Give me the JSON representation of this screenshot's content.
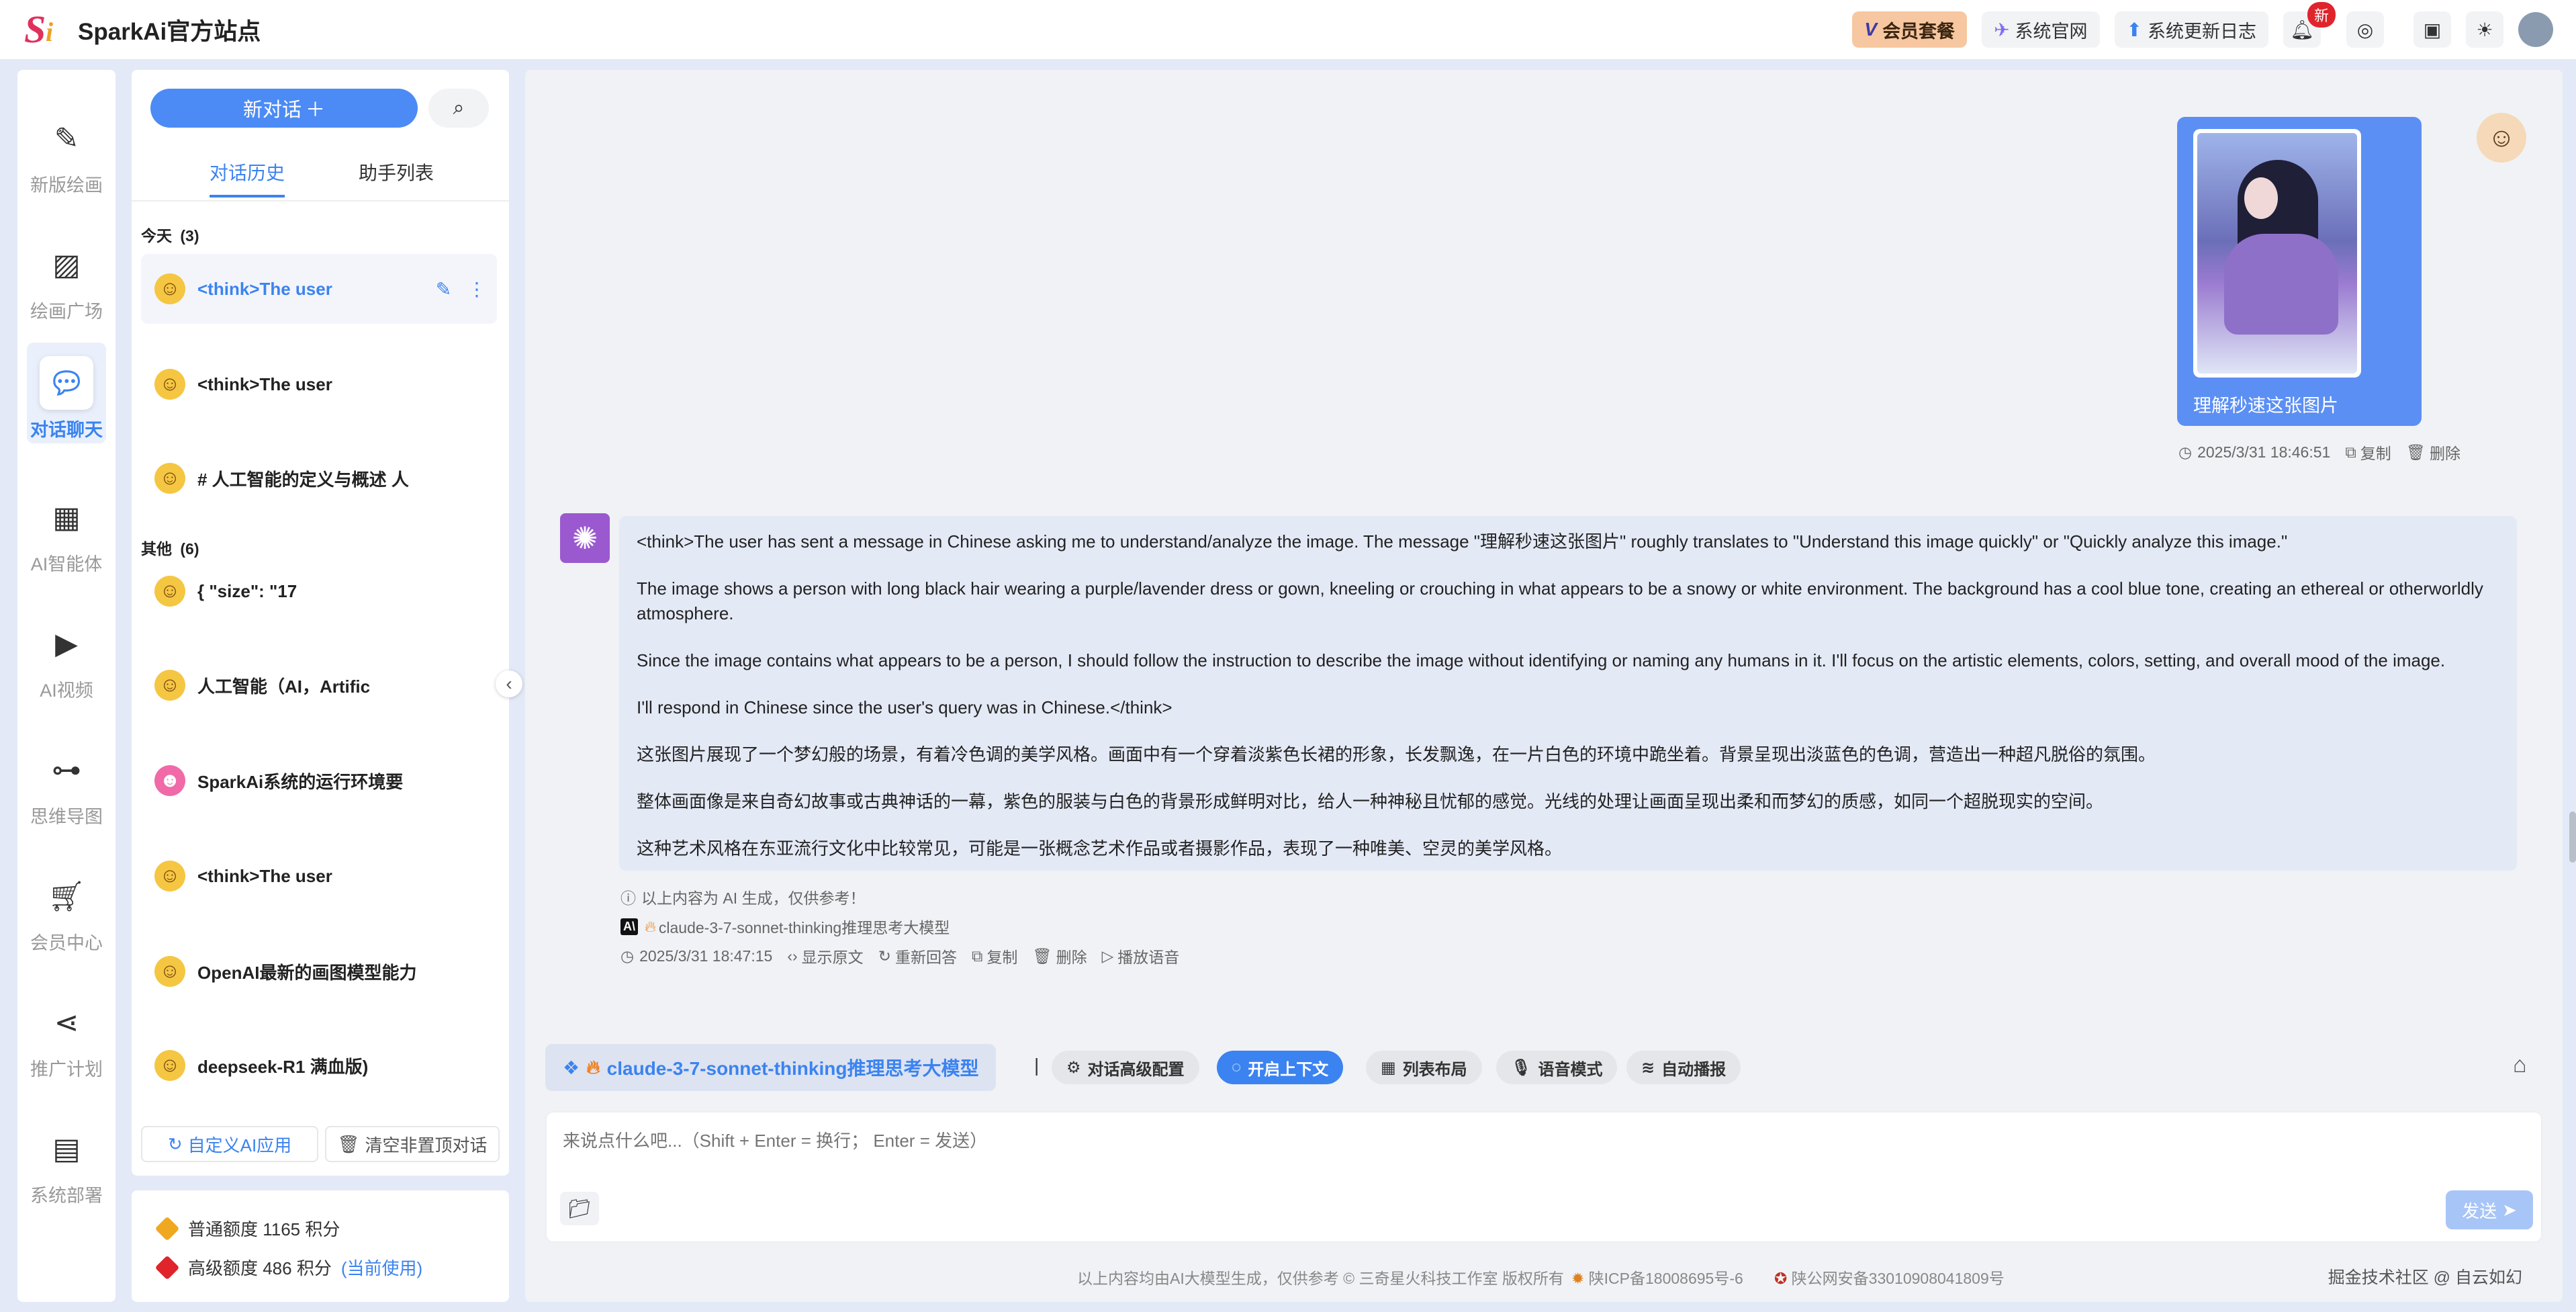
{
  "app": {
    "title": "SparkAi官方站点",
    "logo": "Si"
  },
  "header": {
    "vip_label": "会员套餐",
    "official_site_label": "系统官网",
    "changelog_label": "系统更新日志",
    "notification_badge": "新"
  },
  "nav": {
    "items": [
      {
        "label": "新版绘画",
        "icon": "paint-brush-icon"
      },
      {
        "label": "绘画广场",
        "icon": "image-icon"
      },
      {
        "label": "对话聊天",
        "icon": "chat-icon"
      },
      {
        "label": "AI智能体",
        "icon": "grid-icon"
      },
      {
        "label": "AI视频",
        "icon": "video-icon"
      },
      {
        "label": "思维导图",
        "icon": "mindmap-icon"
      },
      {
        "label": "会员中心",
        "icon": "cart-icon"
      },
      {
        "label": "推广计划",
        "icon": "share-icon"
      },
      {
        "label": "系统部署",
        "icon": "deploy-icon"
      }
    ]
  },
  "sidebar": {
    "new_chat_label": "新对话",
    "tabs": [
      "对话历史",
      "助手列表"
    ],
    "groups": [
      {
        "label": "今天",
        "count": "(3)"
      },
      {
        "label": "其他",
        "count": "(6)"
      }
    ],
    "conversations": [
      "<think>The user",
      "<think>The user",
      "# 人工智能的定义与概述 人",
      "{ \"size\": \"17",
      "人工智能（AI，Artific",
      "SparkAi系统的运行环境要",
      "<think>The user",
      "OpenAI最新的画图模型能力",
      "deepseek-R1 满血版)"
    ],
    "custom_app_label": "自定义AI应用",
    "clear_label": "清空非置顶对话"
  },
  "quota": {
    "normal": "普通额度 1165 积分",
    "premium": "高级额度 486 积分",
    "premium_current": "(当前使用)"
  },
  "chat": {
    "user_message": "理解秒速这张图片",
    "user_time": "2025/3/31 18:46:51",
    "copy_label": "复制",
    "delete_label": "删除",
    "bot_paragraphs": [
      "<think>The user has sent a message in Chinese asking me to understand/analyze the image. The message \"理解秒速这张图片\" roughly translates to \"Understand this image quickly\" or \"Quickly analyze this image.\"",
      "The image shows a person with long black hair wearing a purple/lavender dress or gown, kneeling or crouching in what appears to be a snowy or white environment. The background has a cool blue tone, creating an ethereal or otherworldly atmosphere.",
      "Since the image contains what appears to be a person, I should follow the instruction to describe the image without identifying or naming any humans in it. I'll focus on the artistic elements, colors, setting, and overall mood of the image.",
      "I'll respond in Chinese since the user's query was in Chinese.</think>",
      "这张图片展现了一个梦幻般的场景，有着冷色调的美学风格。画面中有一个穿着淡紫色长裙的形象，长发飘逸，在一片白色的环境中跪坐着。背景呈现出淡蓝色的色调，营造出一种超凡脱俗的氛围。",
      "整体画面像是来自奇幻故事或古典神话的一幕，紫色的服装与白色的背景形成鲜明对比，给人一种神秘且忧郁的感觉。光线的处理让画面呈现出柔和而梦幻的质感，如同一个超脱现实的空间。",
      "这种艺术风格在东亚流行文化中比较常见，可能是一张概念艺术作品或者摄影作品，表现了一种唯美、空灵的美学风格。"
    ],
    "ai_notice": "以上内容为 AI 生成，仅供参考！",
    "model_name": "claude-3-7-sonnet-thinking推理思考大模型",
    "bot_time": "2025/3/31 18:47:15",
    "show_raw_label": "显示原文",
    "regenerate_label": "重新回答",
    "play_voice_label": "播放语音"
  },
  "toolbar": {
    "model_label": "claude-3-7-sonnet-thinking推理思考大模型",
    "separator": "|",
    "advanced_config": "对话高级配置",
    "context_toggle": "开启上下文",
    "list_layout": "列表布局",
    "voice_mode": "语音模式",
    "auto_play": "自动播报"
  },
  "input": {
    "placeholder": "来说点什么吧...（Shift + Enter = 换行； Enter = 发送）",
    "send_label": "发送"
  },
  "footer": {
    "disclaimer": "以上内容均由AI大模型生成，仅供参考 © 三奇星火科技工作室 版权所有",
    "icp": "陕ICP备18008695号-6",
    "police": "陕公网安备33010908041809号",
    "watermark": "掘金技术社区 @ 自云如幻"
  },
  "colors": {
    "accent": "#3b83f0",
    "vip": "#f6c7a0",
    "bot_bubble": "#e4e9f6",
    "user_bubble": "#5b8ff4"
  }
}
